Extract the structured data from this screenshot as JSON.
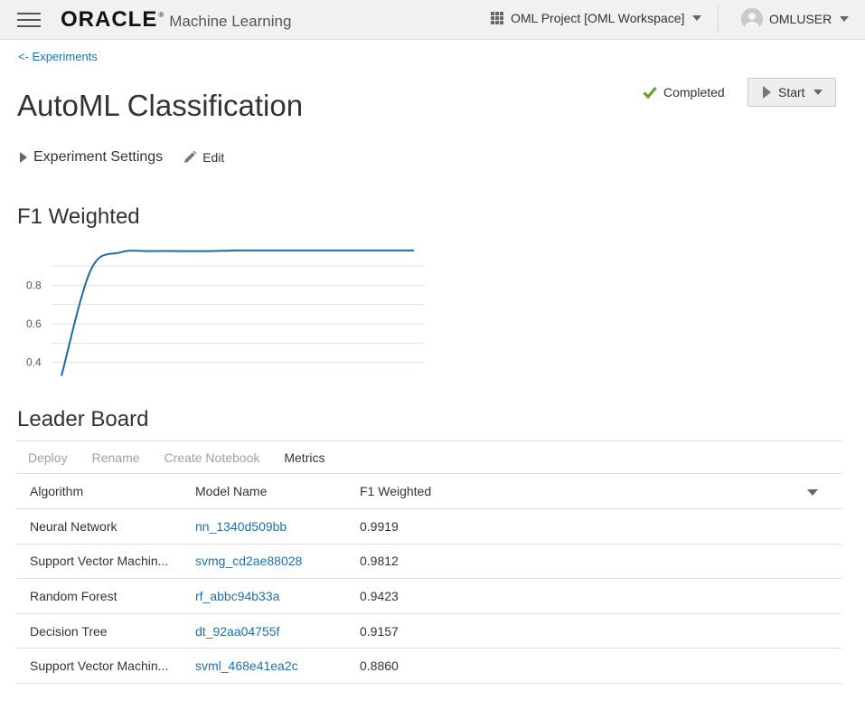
{
  "header": {
    "logo_text": "ORACLE",
    "logo_reg": "®",
    "product_name": "Machine Learning",
    "project_label": "OML Project [OML Workspace]",
    "user_name": "OMLUSER"
  },
  "nav": {
    "back_link": "<- Experiments"
  },
  "page": {
    "title": "AutoML Classification",
    "status": "Completed",
    "start_label": "Start",
    "settings_label": "Experiment Settings",
    "edit_label": "Edit"
  },
  "chart_section": {
    "title": "F1 Weighted"
  },
  "chart_data": {
    "type": "line",
    "title": "F1 Weighted",
    "x": [
      0,
      1,
      2,
      3,
      4,
      5,
      6,
      7,
      8,
      9,
      10,
      11,
      12
    ],
    "series": [
      {
        "values": [
          0.33,
          0.88,
          0.97,
          0.977,
          0.977,
          0.977,
          0.98,
          0.98,
          0.98,
          0.98,
          0.98,
          0.98,
          0.98
        ]
      }
    ],
    "y_ticks": [
      "0.4",
      "0.6",
      "0.8"
    ],
    "ylim": [
      0.3,
      1.05
    ],
    "grid": true,
    "color": "#1e6aa6"
  },
  "leaderboard": {
    "title": "Leader Board",
    "toolbar": [
      "Deploy",
      "Rename",
      "Create Notebook",
      "Metrics"
    ],
    "columns": [
      "Algorithm",
      "Model Name",
      "F1 Weighted"
    ],
    "rows": [
      {
        "algorithm": "Neural Network",
        "model": "nn_1340d509bb",
        "f1": "0.9919"
      },
      {
        "algorithm": "Support Vector Machin...",
        "model": "svmg_cd2ae88028",
        "f1": "0.9812"
      },
      {
        "algorithm": "Random Forest",
        "model": "rf_abbc94b33a",
        "f1": "0.9423"
      },
      {
        "algorithm": "Decision Tree",
        "model": "dt_92aa04755f",
        "f1": "0.9157"
      },
      {
        "algorithm": "Support Vector Machin...",
        "model": "svml_468e41ea2c",
        "f1": "0.8860"
      }
    ]
  },
  "colors": {
    "accent_link": "#1f6fa8",
    "status_ok": "#5aa02c",
    "line_color": "#1e6aa6"
  },
  "icons": {
    "menu": "hamburger-icon",
    "project": "grid-icon",
    "user": "avatar",
    "status": "check-icon",
    "start": "play-icon",
    "edit": "pencil-icon"
  }
}
